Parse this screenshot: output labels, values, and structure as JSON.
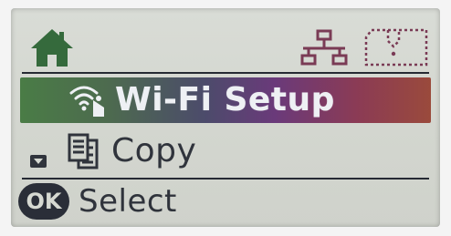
{
  "status_bar": {
    "home_icon": "home-icon",
    "network_icon": "wired-network-icon",
    "card_icon": "memory-card-icon"
  },
  "menu": {
    "items": [
      {
        "label": "Wi-Fi Setup",
        "icon": "wifi-setup-icon",
        "selected": true
      },
      {
        "label": "Copy",
        "icon": "copy-icon",
        "selected": false
      }
    ],
    "scroll_indicator": "down-arrow-icon"
  },
  "footer": {
    "button_label": "OK",
    "hint": "Select"
  },
  "colors": {
    "lcd_background": "#d6d9d2",
    "text": "#30343c",
    "highlight_start": "#4a7c46",
    "highlight_mid": "#6a3a7a",
    "highlight_end": "#9a4a3c",
    "highlight_text": "#eef0f4"
  }
}
